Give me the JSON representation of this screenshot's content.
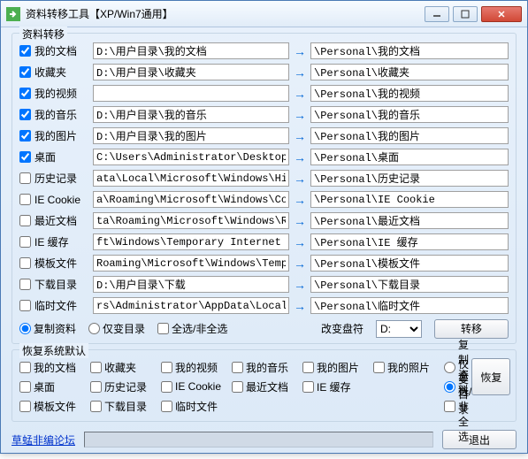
{
  "window": {
    "title": "资料转移工具【XP/Win7通用】"
  },
  "group1": {
    "legend": "资料转移"
  },
  "rows": [
    {
      "checked": true,
      "label": "我的文档",
      "src": "D:\\用户目录\\我的文档",
      "dst": "\\Personal\\我的文档"
    },
    {
      "checked": true,
      "label": "收藏夹",
      "src": "D:\\用户目录\\收藏夹",
      "dst": "\\Personal\\收藏夹"
    },
    {
      "checked": true,
      "label": "我的视频",
      "src": "",
      "dst": "\\Personal\\我的视频"
    },
    {
      "checked": true,
      "label": "我的音乐",
      "src": "D:\\用户目录\\我的音乐",
      "dst": "\\Personal\\我的音乐"
    },
    {
      "checked": true,
      "label": "我的图片",
      "src": "D:\\用户目录\\我的图片",
      "dst": "\\Personal\\我的图片"
    },
    {
      "checked": true,
      "label": "桌面",
      "src": "C:\\Users\\Administrator\\Desktop",
      "dst": "\\Personal\\桌面"
    },
    {
      "checked": false,
      "label": "历史记录",
      "src": "ata\\Local\\Microsoft\\Windows\\History",
      "dst": "\\Personal\\历史记录"
    },
    {
      "checked": false,
      "label": "IE Cookie",
      "src": "a\\Roaming\\Microsoft\\Windows\\Cookies",
      "dst": "\\Personal\\IE Cookie"
    },
    {
      "checked": false,
      "label": "最近文档",
      "src": "ta\\Roaming\\Microsoft\\Windows\\Recent",
      "dst": "\\Personal\\最近文档"
    },
    {
      "checked": false,
      "label": "IE 缓存",
      "src": "ft\\Windows\\Temporary Internet Files",
      "dst": "\\Personal\\IE 缓存"
    },
    {
      "checked": false,
      "label": "模板文件",
      "src": "Roaming\\Microsoft\\Windows\\Templates",
      "dst": "\\Personal\\模板文件"
    },
    {
      "checked": false,
      "label": "下载目录",
      "src": "D:\\用户目录\\下载",
      "dst": "\\Personal\\下载目录"
    },
    {
      "checked": false,
      "label": "临时文件",
      "src": "rs\\Administrator\\AppData\\Local\\Temp",
      "dst": "\\Personal\\临时文件"
    }
  ],
  "ctrl": {
    "radio1": "复制资料",
    "radio2": "仅变目录",
    "selall": "全选/非全选",
    "drivelbl": "改变盘符",
    "drive": "D:",
    "transfer": "转移"
  },
  "group2": {
    "legend": "恢复系统默认"
  },
  "restore": {
    "r1": [
      "我的文档",
      "收藏夹",
      "我的视频",
      "我的音乐",
      "我的图片",
      "我的照片"
    ],
    "r2": [
      "桌面",
      "历史记录",
      "IE Cookie",
      "最近文档",
      "IE 缓存",
      ""
    ],
    "r3": [
      "模板文件",
      "下载目录",
      "临时文件",
      "",
      "",
      ""
    ],
    "radio1": "复制资料",
    "radio2": "仅变目录",
    "selall": "全选/非全选",
    "btn": "恢复"
  },
  "footer": {
    "link": "草蜢非编论坛",
    "exit": "退出"
  }
}
